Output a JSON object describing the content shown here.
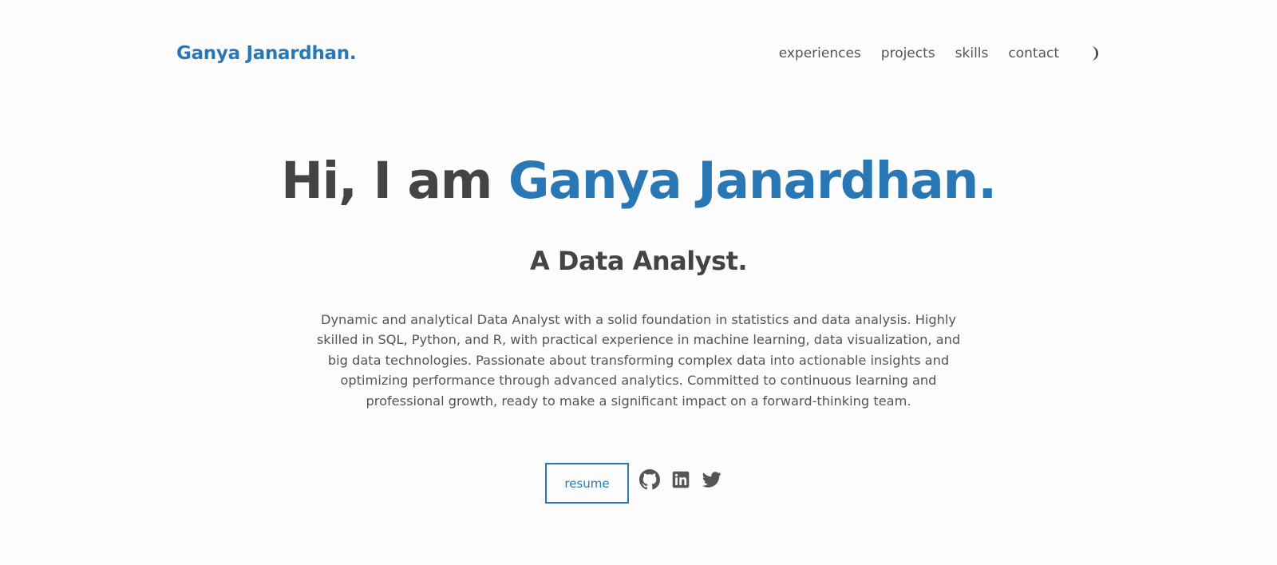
{
  "header": {
    "logo": "Ganya Janardhan.",
    "nav": [
      {
        "label": "experiences"
      },
      {
        "label": "projects"
      },
      {
        "label": "skills"
      },
      {
        "label": "contact"
      }
    ],
    "theme_toggle_icon": "moon-icon"
  },
  "hero": {
    "greeting": "Hi, I am ",
    "name": "Ganya Janardhan.",
    "role": "A Data Analyst.",
    "description": "Dynamic and analytical Data Analyst with a solid foundation in statistics and data analysis. Highly skilled in SQL, Python, and R, with practical experience in machine learning, data visualization, and big data technologies. Passionate about transforming complex data into actionable insights and optimizing performance through advanced analytics. Committed to continuous learning and professional growth, ready to make a significant impact on a forward-thinking team.",
    "resume_label": "resume",
    "social_icons": [
      "github-icon",
      "linkedin-icon",
      "twitter-icon"
    ]
  },
  "colors": {
    "accent": "#2978b5",
    "text": "#444444",
    "muted": "#555555",
    "background": "#fcfcfc"
  }
}
